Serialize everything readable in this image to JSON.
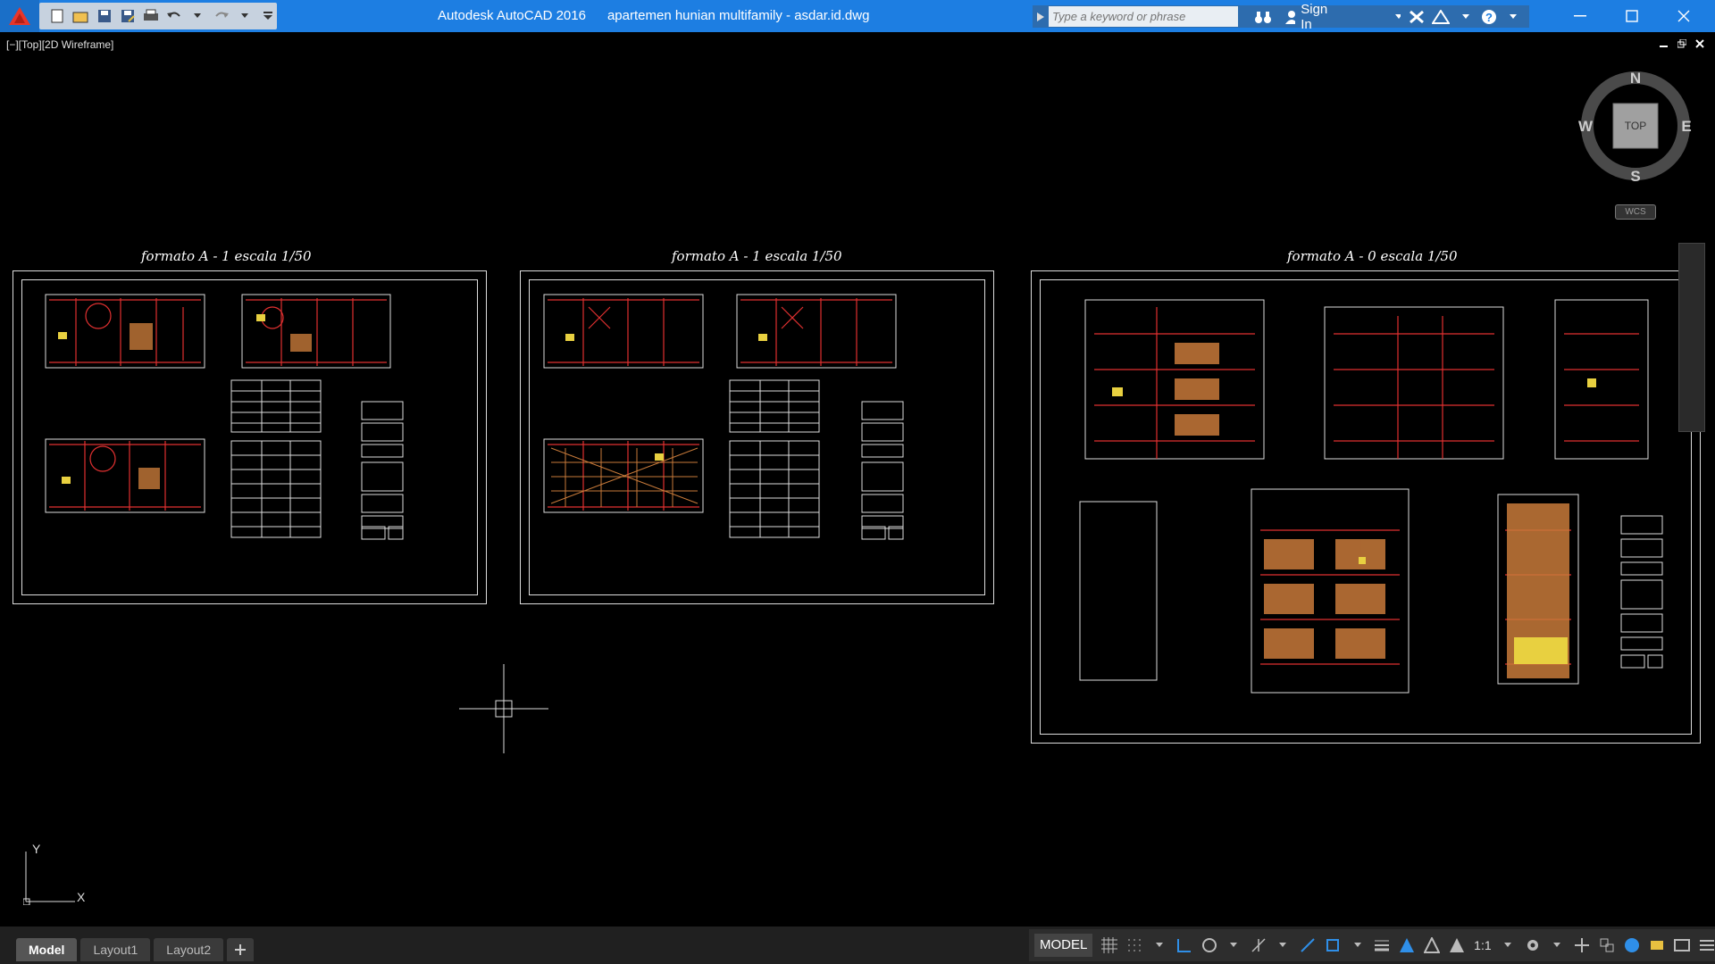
{
  "app": {
    "title": "Autodesk AutoCAD 2016",
    "document": "apartemen hunian multifamily - asdar.id.dwg"
  },
  "search": {
    "placeholder": "Type a keyword or phrase"
  },
  "account": {
    "signin_label": "Sign In"
  },
  "viewport": {
    "label": "[−][Top][2D Wireframe]"
  },
  "sheets": [
    {
      "title": "formato A - 1   escala 1/50"
    },
    {
      "title": "formato A - 1   escala 1/50"
    },
    {
      "title": "formato A - 0   escala 1/50"
    }
  ],
  "viewcube": {
    "face": "TOP",
    "north": "N",
    "south": "S",
    "east": "E",
    "west": "W",
    "wcs": "WCS"
  },
  "ucs": {
    "x_label": "X",
    "y_label": "Y"
  },
  "layout_tabs": [
    "Model",
    "Layout1",
    "Layout2"
  ],
  "status": {
    "model_label": "MODEL",
    "scale": "1:1"
  },
  "colors": {
    "titlebar": "#1d7ee2",
    "drawing_red": "#e03030",
    "drawing_orange": "#c87a3a",
    "drawing_yellow": "#e8d040"
  }
}
